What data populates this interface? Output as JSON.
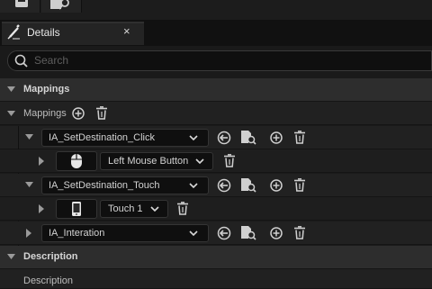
{
  "tab": {
    "title": "Details",
    "close_glyph": "×"
  },
  "search": {
    "placeholder": "Search"
  },
  "sections": {
    "mappings": {
      "label": "Mappings"
    },
    "description": {
      "label": "Description"
    }
  },
  "mappings_property": {
    "label": "Mappings"
  },
  "actions": [
    {
      "name": "IA_SetDestination_Click",
      "expanded": true,
      "key": {
        "device_icon": "mouse-icon",
        "label": "Left Mouse Button"
      }
    },
    {
      "name": "IA_SetDestination_Touch",
      "expanded": true,
      "key": {
        "device_icon": "touch-icon",
        "label": "Touch 1"
      }
    },
    {
      "name": "IA_Interation",
      "expanded": false
    }
  ],
  "description_property": {
    "label": "Description"
  },
  "colors": {
    "panel": "#1a1a1a",
    "header": "#2d2d2d",
    "row": "#212121",
    "field": "#0f0f0f"
  }
}
